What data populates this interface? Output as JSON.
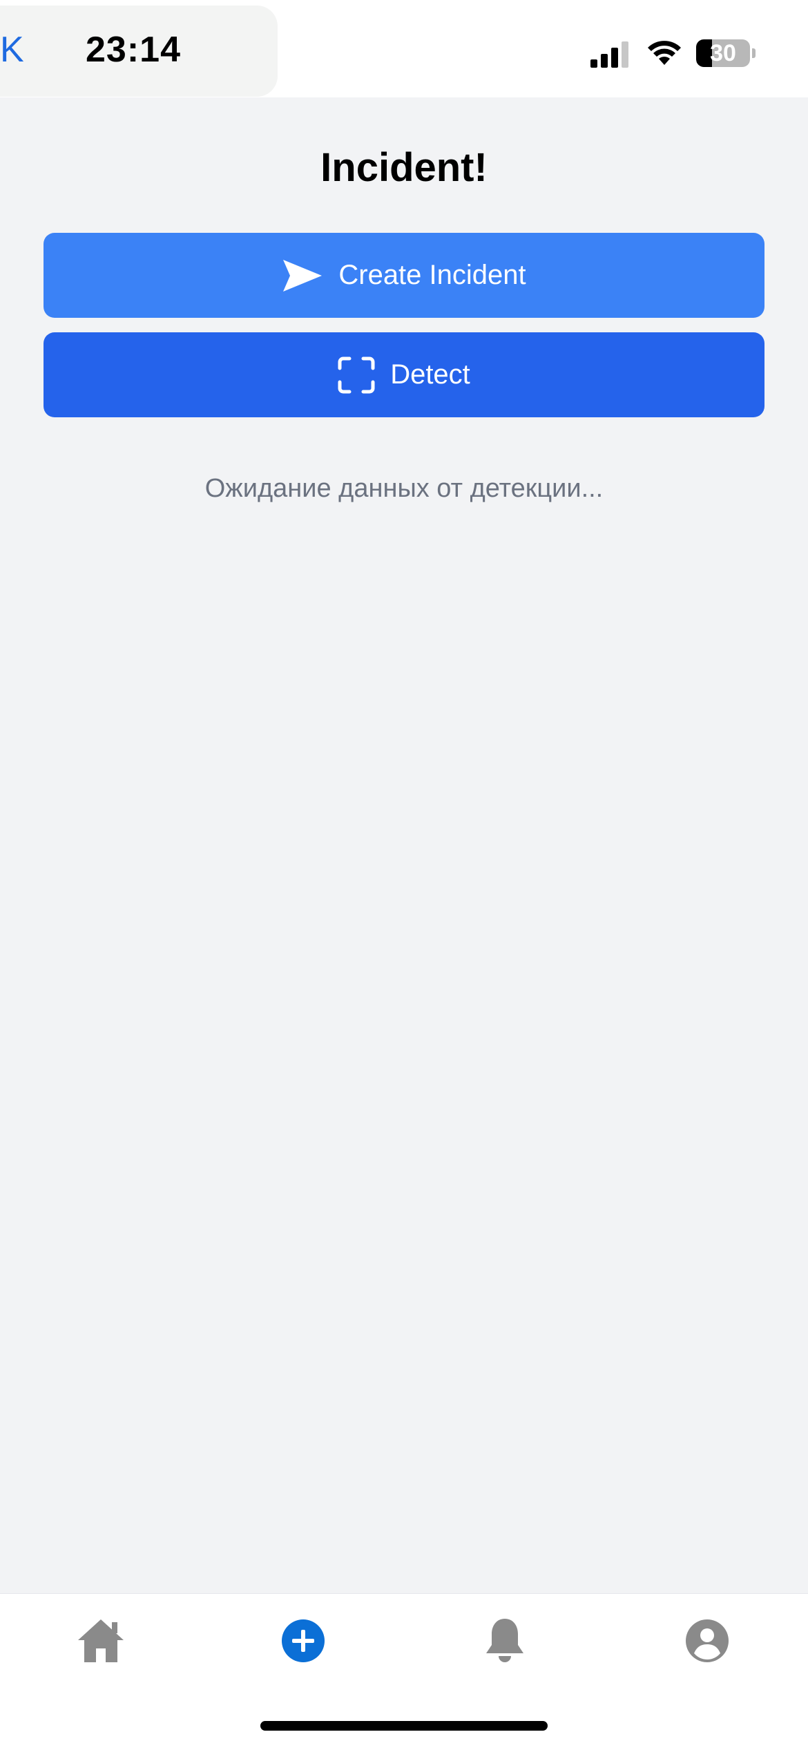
{
  "status_bar": {
    "back_label": "K",
    "time": "23:14",
    "battery_percent": "30",
    "battery_level": 0.3
  },
  "main": {
    "title": "Incident!",
    "create_button_label": "Create Incident",
    "detect_button_label": "Detect",
    "status_message": "Ожидание данных от детекции..."
  },
  "tab_bar": {
    "tabs": [
      {
        "icon": "home-icon"
      },
      {
        "icon": "add-circle-icon",
        "active": true
      },
      {
        "icon": "bell-icon"
      },
      {
        "icon": "profile-icon"
      }
    ]
  },
  "colors": {
    "background": "#f2f3f5",
    "create_button": "#3b82f6",
    "detect_button": "#2563eb",
    "tab_active": "#0b6fd6",
    "tab_inactive": "#8a8a8a",
    "status_text": "#6b7280"
  }
}
